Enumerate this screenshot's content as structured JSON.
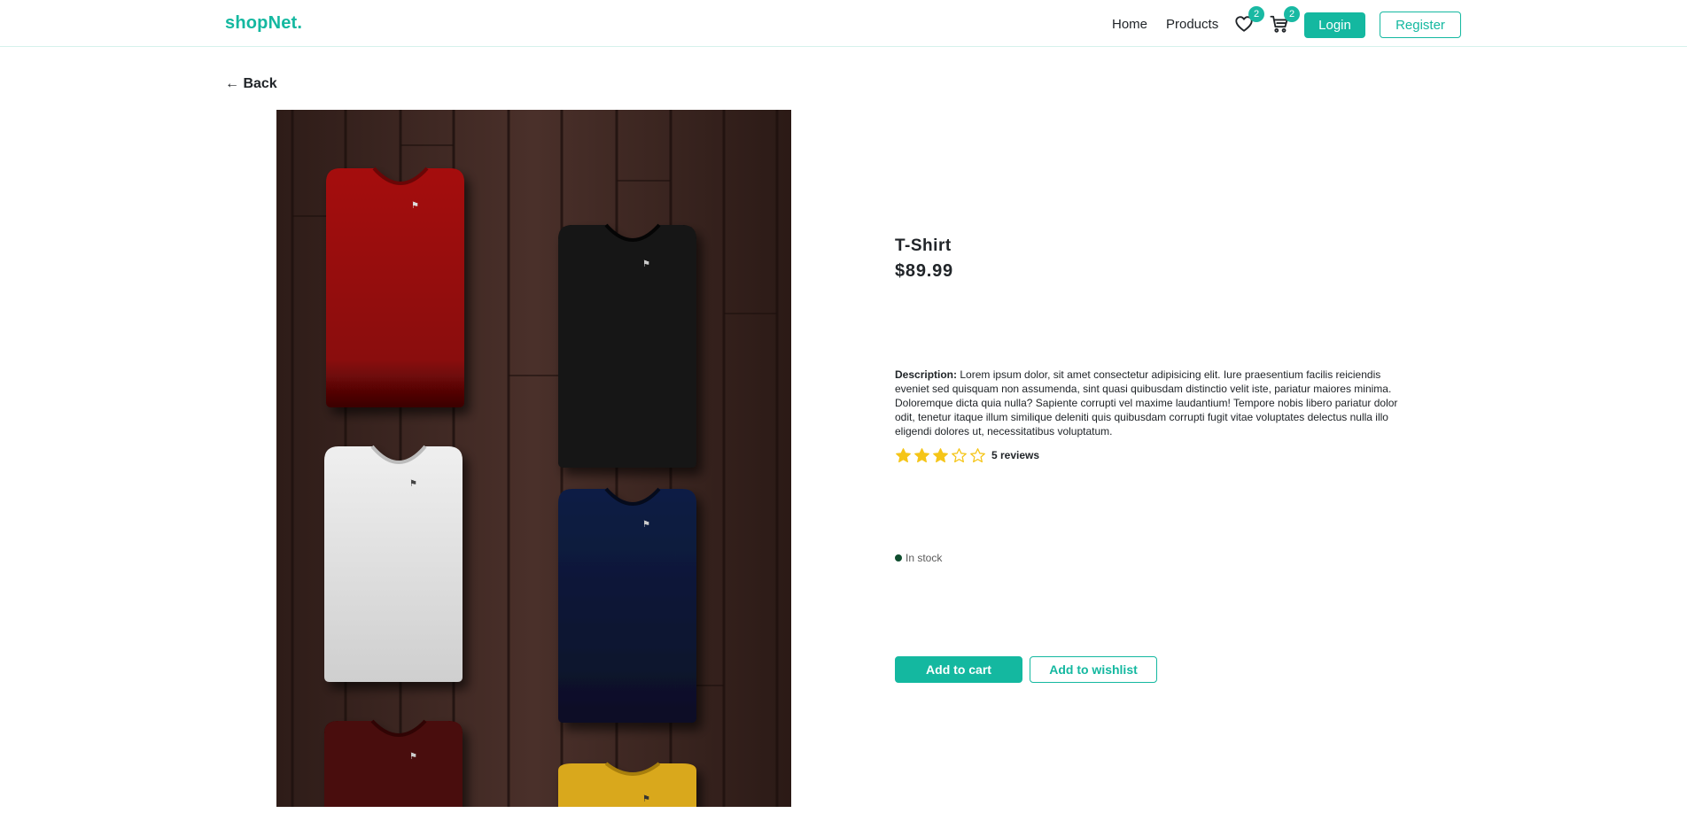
{
  "header": {
    "brand": "shopNet.",
    "nav": {
      "home": "Home",
      "products": "Products"
    },
    "wishlist_count": "2",
    "cart_count": "2",
    "login_label": "Login",
    "register_label": "Register"
  },
  "back_label": "← Back",
  "product": {
    "title": "T-Shirt",
    "price": "$89.99",
    "description_label": "Description:",
    "description": "Lorem ipsum dolor, sit amet consectetur adipisicing elit. Iure praesentium facilis reiciendis eveniet sed quisquam non assumenda, sint quasi quibusdam distinctio velit iste, pariatur maiores minima. Doloremque dicta quia nulla? Sapiente corrupti vel maxime laudantium! Tempore nobis libero pariatur dolor odit, tenetur itaque illum similique deleniti quis quibusdam corrupti fugit vitae voluptates delectus nulla illo eligendi dolores ut, necessitatibus voluptatum.",
    "rating": {
      "value": 3,
      "max": 5
    },
    "reviews_label": "5 reviews",
    "stock_status": "In stock",
    "image_icon": "folded-tshirts-photo"
  },
  "actions": {
    "add_to_cart": "Add to cart",
    "add_to_wishlist": "Add to wishlist"
  },
  "colors": {
    "accent": "#14b8a0",
    "star": "#f5c518",
    "in_stock": "#0f4d2e"
  }
}
